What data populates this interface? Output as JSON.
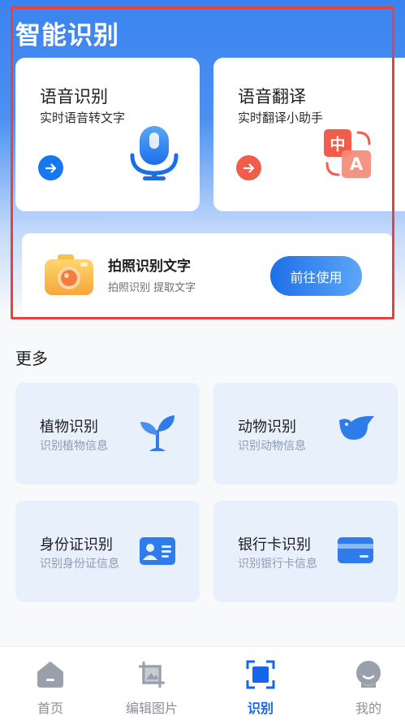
{
  "header": {
    "title": "智能识别"
  },
  "feature_cards": {
    "voice": {
      "title": "语音识别",
      "subtitle": "实时语音转文字",
      "icon": "microphone-icon",
      "accent": "#1677f0"
    },
    "translate": {
      "title": "语音翻译",
      "subtitle": "实时翻译小助手",
      "icon": "translate-icon",
      "icon_text_cn": "中",
      "icon_text_en": "A",
      "accent": "#f25c4b"
    }
  },
  "photo_card": {
    "title": "拍照识别文字",
    "subtitle": "拍照识别 提取文字",
    "button_label": "前往使用",
    "icon": "camera-icon"
  },
  "more": {
    "title": "更多",
    "items": [
      {
        "title": "植物识别",
        "subtitle": "识别植物信息",
        "icon": "plant-icon"
      },
      {
        "title": "动物识别",
        "subtitle": "识别动物信息",
        "icon": "bird-icon"
      },
      {
        "title": "身份证识别",
        "subtitle": "识别身份证信息",
        "icon": "id-card-icon"
      },
      {
        "title": "银行卡识别",
        "subtitle": "识别银行卡信息",
        "icon": "bank-card-icon"
      }
    ]
  },
  "tabbar": {
    "items": [
      {
        "label": "首页",
        "icon": "home-icon",
        "active": false
      },
      {
        "label": "编辑图片",
        "icon": "crop-icon",
        "active": false
      },
      {
        "label": "识别",
        "icon": "scan-icon",
        "active": true
      },
      {
        "label": "我的",
        "icon": "profile-icon",
        "active": false
      }
    ]
  },
  "colors": {
    "primary": "#1566e8",
    "highlight_frame": "#e8413e"
  }
}
